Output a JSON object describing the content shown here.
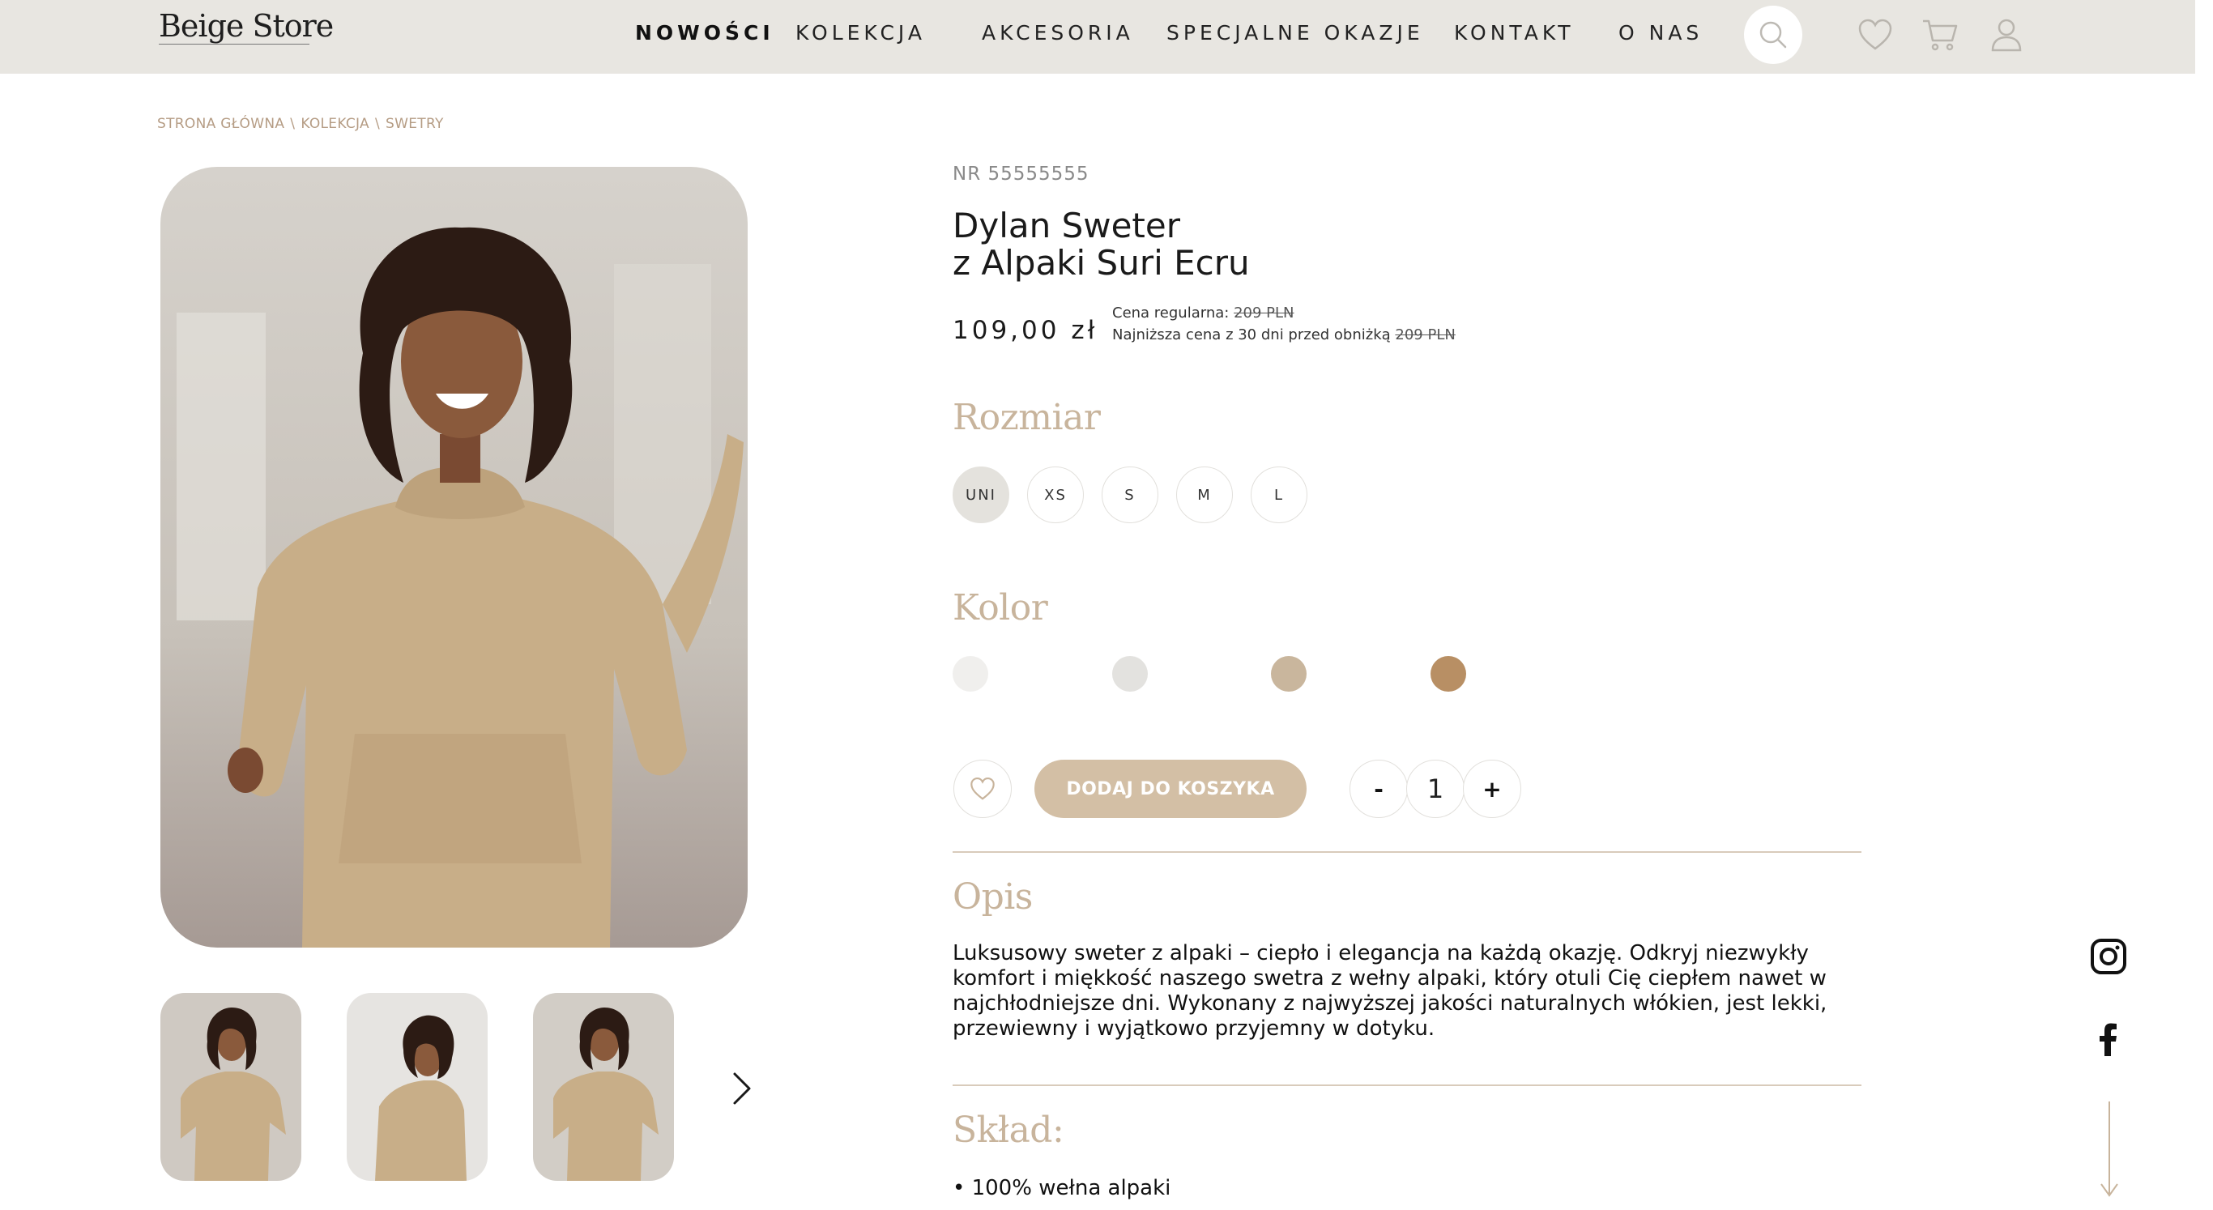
{
  "header": {
    "logo": "Beige Store",
    "nav": [
      "NOWOŚCI",
      "KOLEKCJA",
      "AKCESORIA",
      "SPECJALNE OKAZJE",
      "KONTAKT",
      "O NAS"
    ],
    "icons": [
      "search-icon",
      "heart-icon",
      "cart-icon",
      "user-icon"
    ]
  },
  "breadcrumb": [
    "STRONA GŁÓWNA",
    "KOLEKCJA",
    "SWETRY"
  ],
  "breadcrumb_sep": "\\",
  "product": {
    "sku": "NR 55555555",
    "title_line1": "Dylan Sweter",
    "title_line2": "z Alpaki Suri Ecru",
    "price": "109,00 zł",
    "regular_label": "Cena regularna:",
    "regular_price": "209 PLN",
    "lowest_label": "Najniższa cena z 30 dni przed obniżką",
    "lowest_price": "209 PLN"
  },
  "size": {
    "heading": "Rozmiar",
    "options": [
      "UNI",
      "XS",
      "S",
      "M",
      "L"
    ],
    "selected": "UNI"
  },
  "color": {
    "heading": "Kolor",
    "swatches": [
      "#f0efed",
      "#e3e2df",
      "#c9b69d",
      "#b88f64"
    ]
  },
  "actions": {
    "add_to_cart": "DODAJ DO KOSZYKA",
    "minus": "-",
    "quantity": "1",
    "plus": "+"
  },
  "description": {
    "heading": "Opis",
    "text": "Luksusowy sweter z alpaki – ciepło i elegancja na każdą okazję. Odkryj niezwykły komfort i miękkość naszego swetra z wełny alpaki, który otuli Cię ciepłem nawet w najchłodniejsze dni. Wykonany z najwyższej jakości naturalnych włókien, jest lekki, przewiewny i wyjątkowo przyjemny w dotyku."
  },
  "composition": {
    "heading": "Skład:",
    "items": [
      "• 100% wełna alpaki"
    ]
  },
  "colors": {
    "header_bg": "#e8e6e1",
    "accent": "#d3bfa5",
    "heading": "#c8b49c",
    "breadcrumb": "#b59c84"
  }
}
